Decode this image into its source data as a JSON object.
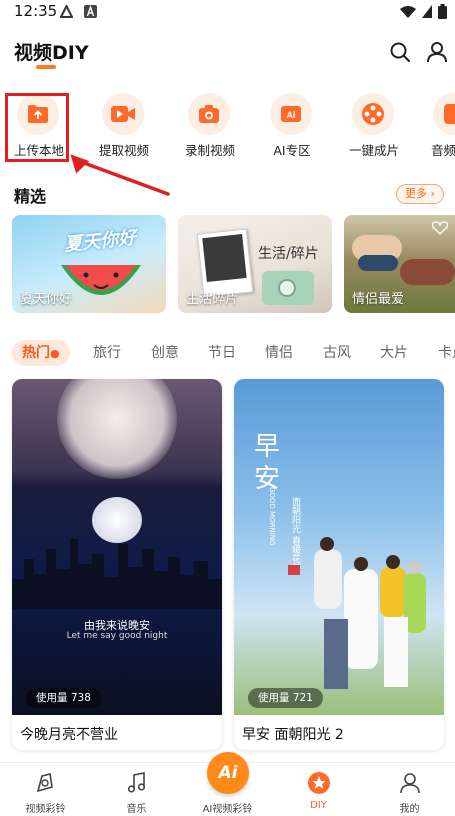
{
  "status_bar": {
    "time": "12:35"
  },
  "header": {
    "title": "视频DIY",
    "icons": [
      "search-icon",
      "user-icon"
    ]
  },
  "categories": [
    {
      "label": "上传本地",
      "icon": "upload-folder-icon"
    },
    {
      "label": "提取视频",
      "icon": "video-extract-icon"
    },
    {
      "label": "录制视频",
      "icon": "camera-icon"
    },
    {
      "label": "AI专区",
      "icon": "ai-icon"
    },
    {
      "label": "一键成片",
      "icon": "film-reel-icon"
    },
    {
      "label": "音频",
      "icon": "audio-icon"
    }
  ],
  "featured": {
    "title": "精选",
    "more_label": "更多",
    "items": [
      {
        "label": "夏天你好",
        "overlay_text": "夏天你好"
      },
      {
        "label": "生活碎片",
        "overlay_text": "生活/碎片"
      },
      {
        "label": "情侣最爱",
        "overlay_text": ""
      }
    ]
  },
  "tabs": [
    "热门",
    "旅行",
    "创意",
    "节日",
    "情侣",
    "古风",
    "大片",
    "卡点"
  ],
  "active_tab": "热门",
  "videos": [
    {
      "usage": "使用量 738",
      "title": "今晚月亮不营业",
      "caption_cn": "由我来说晚安",
      "caption_en": "Let me say good night"
    },
    {
      "usage": "使用量 721",
      "title": "早安 面朝阳光 2",
      "caption_cn": "早安",
      "caption_side": "面朝阳光 春暖花开",
      "caption_en": "GOOD MORNING"
    }
  ],
  "bottom_nav": [
    {
      "label": "视频彩铃",
      "icon": "ringtone-icon"
    },
    {
      "label": "音乐",
      "icon": "music-note-icon"
    },
    {
      "label": "AI视频彩铃",
      "icon": "ai-badge-icon"
    },
    {
      "label": "DIY",
      "icon": "diy-star-icon"
    },
    {
      "label": "我的",
      "icon": "profile-icon"
    }
  ],
  "colors": {
    "accent": "#ff6a1a",
    "highlight": "#e02020",
    "tab_active_bg": "#fde8dc"
  },
  "center_button_text": "Ai"
}
